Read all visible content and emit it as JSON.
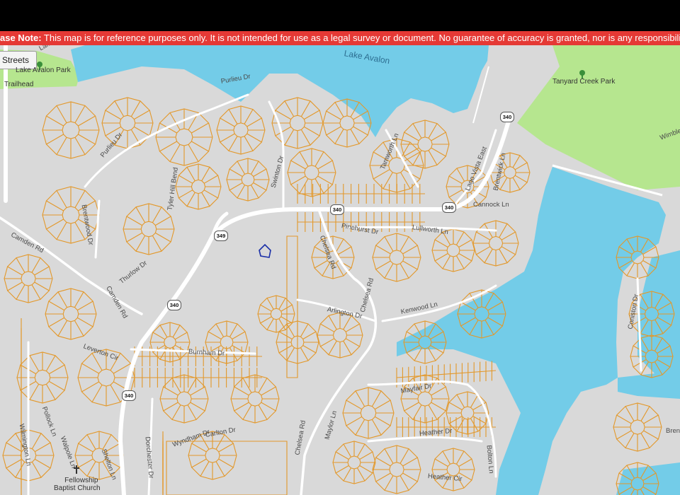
{
  "notice": {
    "prefix": "ase Note:",
    "text": " This map is for reference purposes only. It is not intended for use as a legal survey or document. No guarantee of accuracy is granted, nor is any responsibility for reliance thereon ass"
  },
  "layer_button": {
    "label": "Streets"
  },
  "water_labels": {
    "lake_avalon": "Lake Avalon"
  },
  "poi_labels": {
    "lake_avalon_park": "Lake Avalon Park",
    "trailhead": "Trailhead",
    "tanyard_creek_park": "Tanyard Creek Park",
    "church": "Fellowship Baptist Church",
    "church_line1": "Fellowship",
    "church_line2": "Baptist Church"
  },
  "route_shields": [
    "340",
    "349"
  ],
  "street_labels": {
    "camden_rd": "Camden Rd",
    "camden_rd_2": "Camden Rd",
    "purlieu_dr": "Purlieu Dr",
    "purlieu_dr_2": "Purlieu Dr",
    "swinton_dr": "Swinton Dr",
    "pinehurst_dr": "Pinehurst Dr",
    "chelsea_rd": "Chelsea Rd",
    "chelsea_rd_2": "Chelsea Rd",
    "chelsea_rd_3": "Chelsea Rd",
    "arlington_dr": "Arlington Dr",
    "kenwood_ln": "Kenwood Ln",
    "burnham_dr": "Burnham Dr",
    "thurlow_dr": "Thurlow Dr",
    "mayfair_dr": "Mayfair Dr",
    "heather_dr": "Heather Dr",
    "heather_cir": "Heather Cir",
    "lullworth_ln": "Lullworth Ln",
    "cannock_ln": "Cannock Ln",
    "lago_vista_east": "Lago Vista East",
    "tamworth_ln": "Tamworth Ln",
    "brentwick_ln": "Brentwick Ln",
    "brentwood_dr": "Brentwood Dr",
    "leverton_cir": "Leverton Cir",
    "wilmington_ln": "Wilmington Ln",
    "pollock_ln": "Pollock Ln",
    "walpole_ln": "Walpole Ln",
    "wyndham_dr": "Wyndham Dr",
    "carlton_dr": "Carlton Dr",
    "shelton_ln": "Shelton Ln",
    "dorchester_dr": "Dorchester Dr",
    "tyler_hill_bend": "Tyler Hill Bend",
    "maylor_ln": "Maylor Ln",
    "bolton_ln": "Bolton Ln",
    "coniston_dr": "Coniston Dr",
    "wimbledon": "Wimble",
    "brentwick_rd": "Bren",
    "lake_ln": "Lake"
  },
  "colors": {
    "land": "#d9d9d9",
    "water": "#73cce8",
    "parcel_line": "#e3982a",
    "road": "#ffffff",
    "park": "#b6e68f",
    "notice_bg": "#e53935",
    "marker": "#1a2fa8"
  },
  "icons": [
    "tree-icon",
    "tree-icon",
    "church-cross-icon",
    "parcel-marker-icon"
  ]
}
